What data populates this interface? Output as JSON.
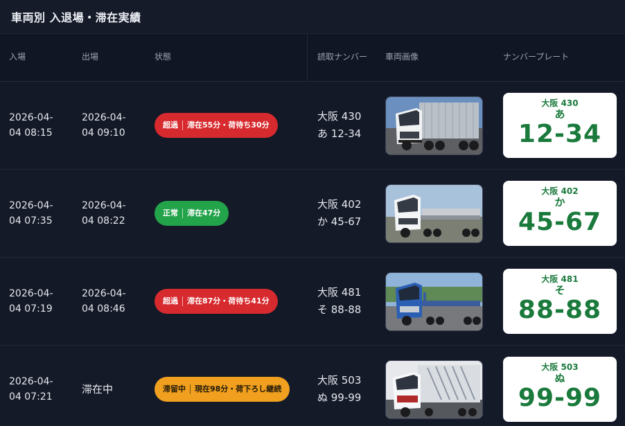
{
  "panel": {
    "title": "車両別 入退場・滞在実績"
  },
  "columns": {
    "entry": "入場",
    "exit": "出場",
    "status": "状態",
    "read": "読取ナンバー",
    "image": "車両画像",
    "plate": "ナンバープレート"
  },
  "rows": [
    {
      "entry_date": "2026-04-",
      "entry_time": "04 08:15",
      "exit_date": "2026-04-",
      "exit_time": "04 09:10",
      "status_kind": "超過",
      "status_detail": "滞在55分・荷待ち30分",
      "status_color": "#d72a2e",
      "read_line1": "大阪 430",
      "read_line2": "あ 12-34",
      "plate_region": "大阪 430",
      "plate_kana": "あ",
      "plate_number": "12-34",
      "truck_color": "silver-wing"
    },
    {
      "entry_date": "2026-04-",
      "entry_time": "04 07:35",
      "exit_date": "2026-04-",
      "exit_time": "04 08:22",
      "status_kind": "正常",
      "status_detail": "滞在47分",
      "status_color": "#23a34a",
      "read_line1": "大阪 402",
      "read_line2": "か 45-67",
      "plate_region": "大阪 402",
      "plate_kana": "か",
      "plate_number": "45-67",
      "truck_color": "white-flatbed"
    },
    {
      "entry_date": "2026-04-",
      "entry_time": "04 07:19",
      "exit_date": "2026-04-",
      "exit_time": "04 08:46",
      "status_kind": "超過",
      "status_detail": "滞在87分・荷待ち41分",
      "status_color": "#d72a2e",
      "read_line1": "大阪 481",
      "read_line2": "そ 88-88",
      "plate_region": "大阪 481",
      "plate_kana": "そ",
      "plate_number": "88-88",
      "truck_color": "blue-flatbed"
    },
    {
      "entry_date": "2026-04-",
      "entry_time": "04 07:21",
      "exit_label": "滞在中",
      "status_kind": "滞留中",
      "status_detail": "現在98分・荷下ろし継続",
      "status_color": "#f0a01e",
      "read_line1": "大阪 503",
      "read_line2": "ぬ 99-99",
      "plate_region": "大阪 503",
      "plate_kana": "ぬ",
      "plate_number": "99-99",
      "truck_color": "white-wing"
    }
  ],
  "colors": {
    "background": "#141927",
    "plate_text": "#1a7a3c",
    "red": "#d72a2e",
    "green": "#23a34a",
    "amber": "#f0a01e"
  }
}
